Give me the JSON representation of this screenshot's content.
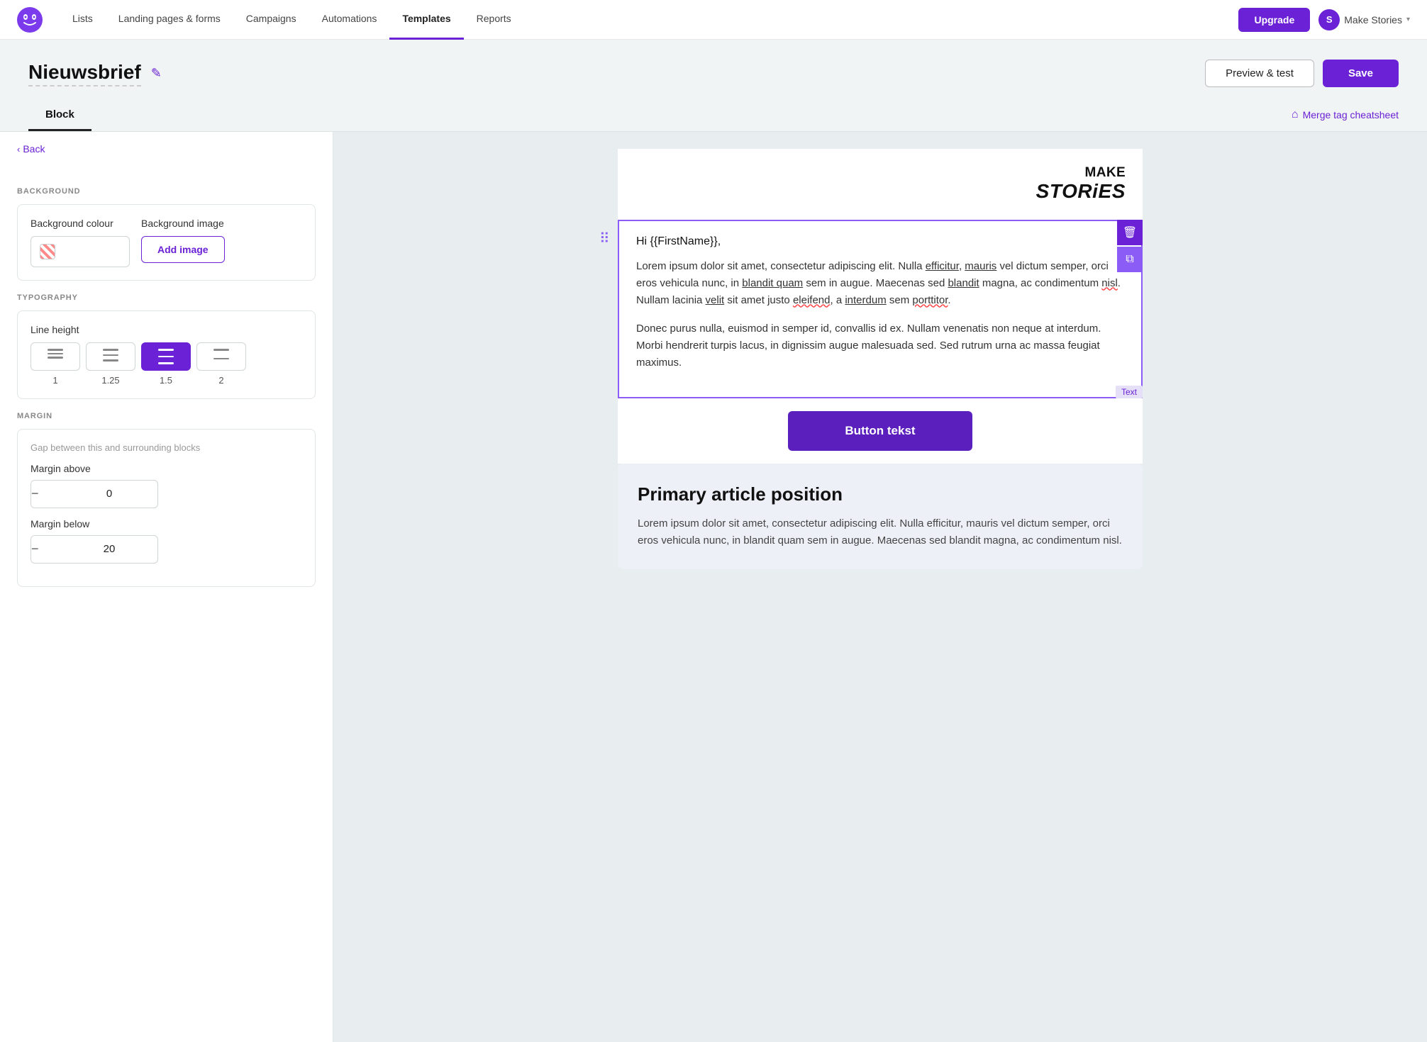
{
  "nav": {
    "logo_alt": "Headlime logo",
    "links": [
      {
        "label": "Lists",
        "active": false
      },
      {
        "label": "Landing pages & forms",
        "active": false
      },
      {
        "label": "Campaigns",
        "active": false
      },
      {
        "label": "Automations",
        "active": false
      },
      {
        "label": "Templates",
        "active": true
      },
      {
        "label": "Reports",
        "active": false
      }
    ],
    "upgrade_label": "Upgrade",
    "user_initial": "S",
    "user_name": "Make Stories",
    "chevron": "▾"
  },
  "toolbar": {
    "page_title": "Nieuwsbrief",
    "preview_label": "Preview & test",
    "save_label": "Save"
  },
  "tabs": {
    "items": [
      {
        "label": "Block",
        "active": true
      }
    ],
    "merge_tag_label": "Merge tag cheatsheet"
  },
  "sidebar": {
    "back_label": "Back",
    "background_section": "BACKGROUND",
    "bg_colour_label": "Background colour",
    "bg_image_label": "Background image",
    "add_image_label": "Add image",
    "typography_section": "TYPOGRAPHY",
    "line_height_label": "Line height",
    "line_heights": [
      {
        "value": "1",
        "active": false
      },
      {
        "value": "1.25",
        "active": false
      },
      {
        "value": "1.5",
        "active": true
      },
      {
        "value": "2",
        "active": false
      }
    ],
    "margin_section": "MARGIN",
    "margin_desc": "Gap between this and surrounding blocks",
    "margin_above_label": "Margin above",
    "margin_above_value": "0",
    "margin_above_unit": "px",
    "margin_below_label": "Margin below",
    "margin_below_value": "20",
    "margin_below_unit": "px"
  },
  "canvas": {
    "logo_make": "MAKE",
    "logo_stories": "STORiES",
    "greeting": "Hi {{FirstName}},",
    "paragraph1": "Lorem ipsum dolor sit amet, consectetur adipiscing elit. Nulla efficitur, mauris vel dictum semper, orci eros vehicula nunc, in blandit quam sem in augue. Maecenas sed blandit magna, ac condimentum nisl. Nullam lacinia velit sit amet justo eleifend, a interdum sem porttitor.",
    "paragraph2": "Donec purus nulla, euismod in semper id, convallis id ex. Nullam venenatis non neque at interdum. Morbi hendrerit turpis lacus, in dignissim augue malesuada sed. Sed rutrum urna ac massa feugiat maximus.",
    "text_label": "Text",
    "button_label": "Button tekst",
    "article_title": "Primary article position",
    "article_body": "Lorem ipsum dolor sit amet, consectetur adipiscing elit. Nulla efficitur, mauris vel dictum semper, orci eros vehicula nunc, in blandit quam sem in augue. Maecenas sed blandit magna, ac condimentum nisl."
  }
}
